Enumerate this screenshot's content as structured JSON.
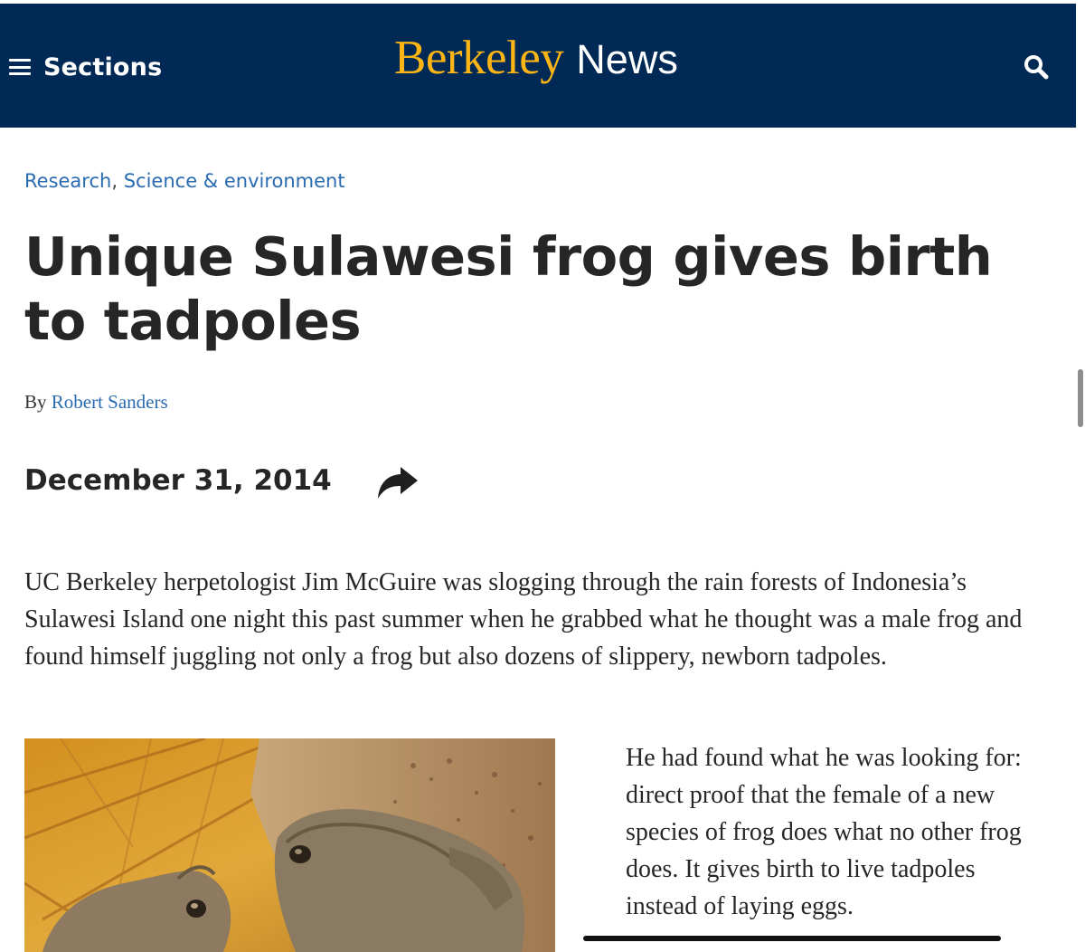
{
  "colors": {
    "header_bg": "#002a55",
    "logo_gold": "#fdb515",
    "link_blue": "#2a6bb2"
  },
  "header": {
    "menu_icon": "hamburger-menu-icon",
    "sections_label": "Sections",
    "logo_berkeley": "Berkeley",
    "logo_news": "News",
    "search_icon": "search-icon"
  },
  "article": {
    "categories": [
      "Research",
      "Science & environment"
    ],
    "category_separator": ",",
    "title": "Unique Sulawesi frog gives birth to tadpoles",
    "byline_prefix": "By",
    "author": "Robert Sanders",
    "date": "December 31, 2014",
    "share_icon": "share-arrow-icon",
    "paragraph_1": "UC Berkeley herpetologist Jim McGuire was slogging through the rain forests of Indonesia’s Sulawesi Island one night this past summer when he grabbed what he thought was a male frog and found himself juggling not only a frog but also dozens of slippery, newborn tadpoles.",
    "photo": "photo of two brown frogs on dry leaves",
    "paragraph_2": "He had found what he was looking for: direct proof that the female of a new species of frog does what no other frog does. It gives birth to live tadpoles instead of laying eggs."
  }
}
